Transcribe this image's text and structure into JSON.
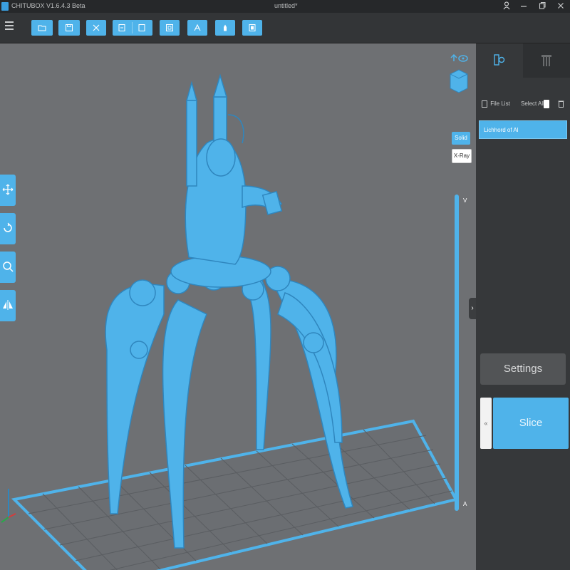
{
  "window": {
    "app_title": "CHITUBOX V1.6.4.3 Beta",
    "doc_title": "untitled*",
    "controls": [
      "user-icon",
      "minimize-icon",
      "restore-icon",
      "close-icon"
    ]
  },
  "toolbar": {
    "buttons": [
      "open-icon",
      "save-icon",
      "cut-icon",
      "new-model-icon",
      "copy-model-icon",
      "hollow-icon",
      "text-icon",
      "support-icon",
      "export-icon"
    ]
  },
  "viewport": {
    "view_modes": {
      "solid": "Solid",
      "xray": "X-Ray"
    },
    "layer_slider": {
      "top_label": "V",
      "bottom_label": "A"
    },
    "left_tools": [
      "move-icon",
      "rotate-icon",
      "scale-icon",
      "mirror-icon"
    ],
    "model_color": "#4fb3ea",
    "background_color": "#6e7073"
  },
  "panel": {
    "tabs": [
      "model-settings-tab",
      "supports-tab"
    ],
    "file_list": {
      "label": "File List",
      "select_all": "Select All",
      "files": [
        "Lichhord of Al"
      ]
    },
    "settings_label": "Settings",
    "slice_label": "Slice"
  },
  "colors": {
    "accent": "#4fb3ea",
    "panel_bg": "#36383a",
    "toolbar_bg": "#333537"
  }
}
